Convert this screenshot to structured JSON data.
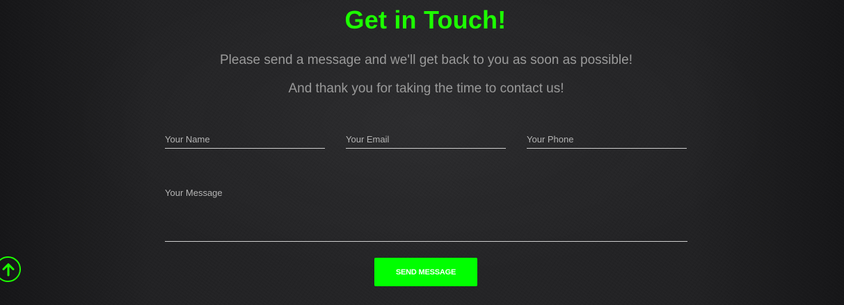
{
  "contact": {
    "heading": "Get in Touch!",
    "subtitle_line1": "Please send a message and we'll get back to you as soon as possible!",
    "subtitle_line2": "And thank you for taking the time to contact us!"
  },
  "form": {
    "name_placeholder": "Your Name",
    "name_value": "",
    "email_placeholder": "Your Email",
    "email_value": "",
    "phone_placeholder": "Your Phone",
    "phone_value": "",
    "message_placeholder": "Your Message",
    "message_value": "",
    "submit_label": "SEND MESSAGE"
  },
  "scroll_top": {
    "icon": "arrow-up-icon"
  },
  "colors": {
    "accent": "#1cff00",
    "button_bg": "#00ff00",
    "background": "#232325",
    "subtitle_text": "#9a9a9a",
    "field_underline": "#cfcfcf"
  }
}
